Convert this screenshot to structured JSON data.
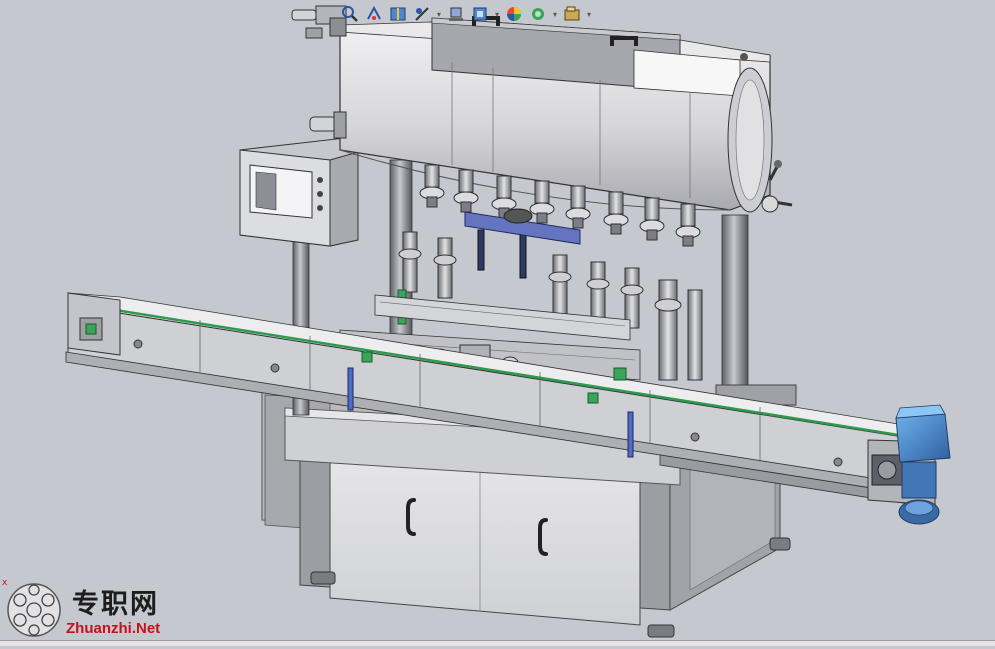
{
  "watermark": {
    "brand_cn": "专职网",
    "brand_en": "Zhuanzhi.Net",
    "corner_mark": "x"
  },
  "toolbar": {
    "icons": [
      "zoom-icon",
      "view-orient-icon",
      "section-view-icon",
      "display-style-icon",
      "hide-show-icon",
      "appearance-icon",
      "scene-icon",
      "view-settings-icon"
    ]
  },
  "colors": {
    "background": "#c5c8cf",
    "metal_light": "#e8e8ea",
    "metal_mid": "#b9b9be",
    "metal_dark": "#8c8c93",
    "accent_blue": "#3d7fc9",
    "accent_green": "#3aa55a",
    "brand_red": "#c8101a"
  }
}
